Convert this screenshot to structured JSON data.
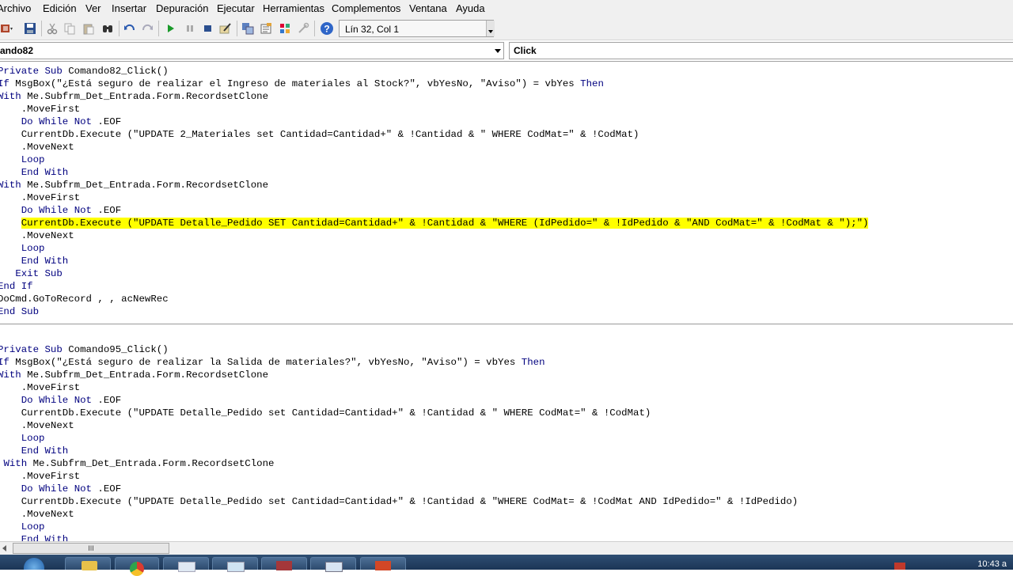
{
  "menu": {
    "items": [
      "Archivo",
      "Edición",
      "Ver",
      "Insertar",
      "Depuración",
      "Ejecutar",
      "Herramientas",
      "Complementos",
      "Ventana",
      "Ayuda"
    ]
  },
  "toolbar": {
    "position_label": "Lín 32, Col 1",
    "icons": [
      "access-icon",
      "save-icon",
      "cut-icon",
      "copy-icon",
      "paste-icon",
      "find-icon",
      "undo-icon",
      "redo-icon",
      "run-icon",
      "pause-icon",
      "stop-icon",
      "design-mode-icon",
      "project-explorer-icon",
      "properties-icon",
      "object-browser-icon",
      "toolbox-icon",
      "help-icon"
    ]
  },
  "object_combo": {
    "value": "ando82"
  },
  "procedure_combo": {
    "value": "Click"
  },
  "code": {
    "procedure1": [
      "Private Sub Comando82_Click()",
      "If MsgBox(\"¿Está seguro de realizar el Ingreso de materiales al Stock?\", vbYesNo, \"Aviso\") = vbYes Then",
      "With Me.Subfrm_Det_Entrada.Form.RecordsetClone",
      "    .MoveFirst",
      "    Do While Not .EOF",
      "    CurrentDb.Execute (\"UPDATE 2_Materiales set Cantidad=Cantidad+\" & !Cantidad & \" WHERE CodMat=\" & !CodMat)",
      "    .MoveNext",
      "    Loop",
      "    End With",
      "With Me.Subfrm_Det_Entrada.Form.RecordsetClone",
      "    .MoveFirst",
      "    Do While Not .EOF",
      "    CurrentDb.Execute (\"UPDATE Detalle_Pedido SET Cantidad=Cantidad+\" & !Cantidad & \"WHERE (IdPedido=\" & !IdPedido & \"AND CodMat=\" & !CodMat & \");\")",
      "    .MoveNext",
      "    Loop",
      "    End With",
      "   Exit Sub",
      "End If",
      "DoCmd.GoToRecord , , acNewRec",
      "End Sub"
    ],
    "procedure2": [
      "Private Sub Comando95_Click()",
      "If MsgBox(\"¿Está seguro de realizar la Salida de materiales?\", vbYesNo, \"Aviso\") = vbYes Then",
      "With Me.Subfrm_Det_Entrada.Form.RecordsetClone",
      "    .MoveFirst",
      "    Do While Not .EOF",
      "    CurrentDb.Execute (\"UPDATE Detalle_Pedido set Cantidad=Cantidad+\" & !Cantidad & \" WHERE CodMat=\" & !CodMat)",
      "    .MoveNext",
      "    Loop",
      "    End With",
      " With Me.Subfrm_Det_Entrada.Form.RecordsetClone",
      "    .MoveFirst",
      "    Do While Not .EOF",
      "    CurrentDb.Execute (\"UPDATE Detalle_Pedido set Cantidad=Cantidad+\" & !Cantidad & \"WHERE CodMat= & !CodMat AND IdPedido=\" & !IdPedido)",
      "    .MoveNext",
      "    Loop",
      "    End With"
    ],
    "highlighted_line": 12
  },
  "scrollbar": {
    "thumb_label": "III"
  },
  "taskbar": {
    "clock": "10:43 a"
  },
  "colors": {
    "keyword": "#00007f",
    "highlight": "#ffff00",
    "chrome": "#f0f0f0"
  }
}
